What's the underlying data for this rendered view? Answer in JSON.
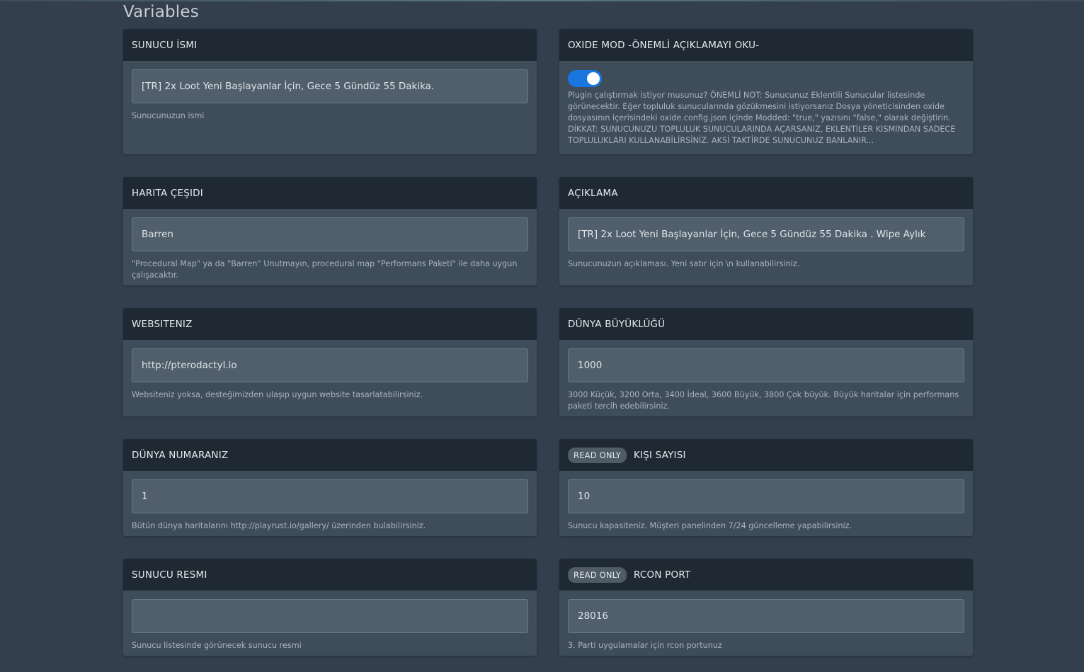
{
  "page": {
    "title": "Variables"
  },
  "cards": {
    "sunucu_ismi": {
      "title": "SUNUCU İSMI",
      "value": "[TR] 2x Loot Yeni Başlayanlar İçin, Gece 5 Gündüz 55 Dakika.",
      "description": "Sunucunuzun ismi"
    },
    "oxide_mod": {
      "title": "OXIDE MOD -ÖNEMLİ AÇIKLAMAYI OKU-",
      "toggle_on": true,
      "description": "Plugin çalıştırmak istiyor musunuz? ÖNEMLİ NOT: Sunucunuz Eklentili Sunucular listesinde görünecektir. Eğer topluluk sunucularında gözükmesini istiyorsanız Dosya yöneticisinden oxide dosyasının içerisindeki oxide.config.json içinde Modded: \"true,\" yazısını \"false,\" olarak değiştirin. DİKKAT: SUNUCUNUZU TOPLULUK SUNUCULARINDA AÇARSANIZ, EKLENTİLER KISMINDAN SADECE TOPLULUKLARI KULLANABİLİRSİNİZ. AKSİ TAKTİRDE SUNUCUNUZ BANLANIR..."
    },
    "harita_cesidi": {
      "title": "HARITA ÇEŞIDI",
      "value": "Barren",
      "description": "\"Procedural Map\" ya da \"Barren\" Unutmayın, procedural map \"Performans Paketi\" ile daha uygun çalışacaktır."
    },
    "aciklama": {
      "title": "AÇIKLAMA",
      "value": "[TR] 2x Loot Yeni Başlayanlar İçin, Gece 5 Gündüz 55 Dakika . Wipe Aylık",
      "description": "Sunucunuzun açıklaması. Yeni satır için \\n kullanabilirsiniz."
    },
    "websiteniz": {
      "title": "WEBSITENIZ",
      "value": "http://pterodactyl.io",
      "description": "Websiteniz yoksa, desteğimizden ulaşıp uygun website tasarlatabilirsiniz."
    },
    "dunya_buyuklugu": {
      "title": "DÜNYA BÜYÜKLÜĞÜ",
      "value": "1000",
      "description": "3000 Küçük, 3200 Orta, 3400 İdeal, 3600 Büyük, 3800 Çok büyük. Büyük haritalar için performans paketi tercih edebilirsiniz."
    },
    "dunya_numaraniz": {
      "title": "DÜNYA NUMARANIZ",
      "value": "1",
      "description": "Bütün dünya haritalarını http://playrust.io/gallery/ üzerinden bulabilirsiniz."
    },
    "kisi_sayisi": {
      "badge": "READ ONLY",
      "title": "KIŞI SAYISI",
      "value": "10",
      "description": "Sunucu kapasiteniz. Müşteri panelinden 7/24 güncelleme yapabilirsiniz."
    },
    "sunucu_resmi": {
      "title": "SUNUCU RESMI",
      "value": "",
      "description": "Sunucu listesinde görünecek sunucu resmi"
    },
    "rcon_port": {
      "badge": "READ ONLY",
      "title": "RCON PORT",
      "value": "28016",
      "description": "3. Parti uygulamalar için rcon portunuz"
    }
  },
  "colors": {
    "background": "#333f4d",
    "card": "#3f4d5a",
    "card_header": "#1f2933",
    "input": "#515f6c",
    "toggle_accent": "#1976e0"
  }
}
